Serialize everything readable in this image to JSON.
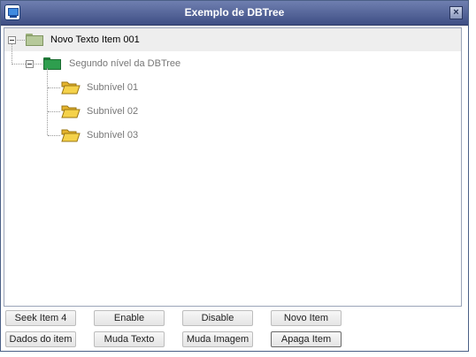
{
  "window": {
    "title": "Exemplo de DBTree",
    "close_label": "×"
  },
  "tree": {
    "root": "Novo Texto Item 001",
    "child": "Segundo nível da DBTree",
    "subitems": [
      "Subnível 01",
      "Subnível 02",
      "Subnível 03"
    ]
  },
  "buttons": {
    "seek": "Seek Item 4",
    "enable": "Enable",
    "disable": "Disable",
    "novo_item": "Novo Item",
    "dados": "Dados do item",
    "muda_texto": "Muda Texto",
    "muda_imagem": "Muda Imagem",
    "apaga_item": "Apaga Item"
  },
  "icons": {
    "root_folder": "light-green-folder-icon",
    "child_folder": "green-folder-icon",
    "sub_folder": "yellow-open-folder-icon"
  },
  "colors": {
    "titlebar": "#4f5f95",
    "selected_row": "#eeeeee",
    "root_folder": "#b6c99a",
    "child_folder": "#2e9e4e",
    "sub_folder": "#f5d24a"
  }
}
